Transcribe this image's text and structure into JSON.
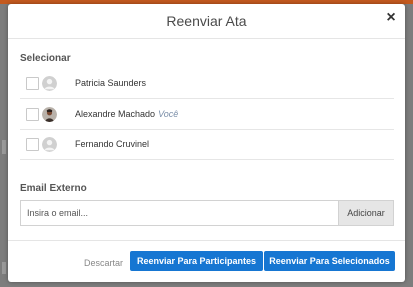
{
  "modal": {
    "title": "Reenviar Ata",
    "close_icon": "close-icon"
  },
  "select_section": {
    "label": "Selecionar",
    "participants": [
      {
        "name": "Patricia Saunders",
        "tag": "",
        "checked": false,
        "avatar": "default-avatar-icon"
      },
      {
        "name": "Alexandre Machado",
        "tag": "Você",
        "checked": false,
        "avatar": "user-photo-avatar"
      },
      {
        "name": "Fernando Cruvinel",
        "tag": "",
        "checked": false,
        "avatar": "default-avatar-icon"
      }
    ]
  },
  "external_email": {
    "label": "Email Externo",
    "placeholder": "Insira o email...",
    "value": "",
    "add_label": "Adicionar"
  },
  "footer": {
    "discard_label": "Descartar",
    "resend_participants_label": "Reenviar Para Participantes",
    "resend_selected_label": "Reenviar Para Selecionados"
  },
  "colors": {
    "primary": "#1676d2",
    "header_accent": "#c45a1f",
    "backdrop": "#7d7d7d"
  }
}
